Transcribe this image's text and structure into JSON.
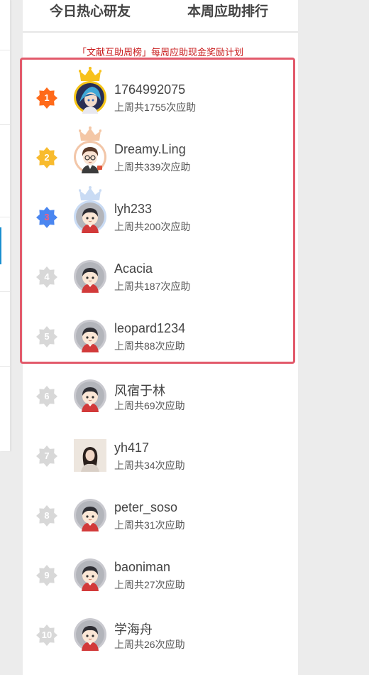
{
  "tabs": [
    {
      "label": "今日热心研友"
    },
    {
      "label": "本周应助排行"
    }
  ],
  "notice": "「文献互助周榜」每周应助现金奖励计划",
  "ranking": [
    {
      "rank": "1",
      "name": "1764992075",
      "stat": "上周共1755次应助",
      "badge_color": "#ff6a1a",
      "crown_color": "#f7c11a",
      "avatar": "anime-avatar"
    },
    {
      "rank": "2",
      "name": "Dreamy.Ling",
      "stat": "上周共339次应助",
      "badge_color": "#f8bb2e",
      "crown_color": "#f4c7a6",
      "avatar": "cartoon-boy-avatar"
    },
    {
      "rank": "3",
      "name": "lyh233",
      "stat": "上周共200次应助",
      "badge_color": "#4a86f0",
      "crown_color": "#c9dbf4",
      "avatar": "default-avatar"
    },
    {
      "rank": "4",
      "name": "Acacia",
      "stat": "上周共187次应助",
      "badge_color": "#d8d8d8",
      "avatar": "default-avatar"
    },
    {
      "rank": "5",
      "name": "leopard1234",
      "stat": "上周共88次应助",
      "badge_color": "#d8d8d8",
      "avatar": "default-avatar"
    },
    {
      "rank": "6",
      "name": "风宿于林",
      "stat": "上周共69次应助",
      "badge_color": "#d8d8d8",
      "avatar": "default-avatar"
    },
    {
      "rank": "7",
      "name": "yh417",
      "stat": "上周共34次应助",
      "badge_color": "#d8d8d8",
      "avatar": "photo-avatar"
    },
    {
      "rank": "8",
      "name": "peter_soso",
      "stat": "上周共31次应助",
      "badge_color": "#d8d8d8",
      "avatar": "default-avatar"
    },
    {
      "rank": "9",
      "name": "baoniman",
      "stat": "上周共27次应助",
      "badge_color": "#d8d8d8",
      "avatar": "default-avatar"
    },
    {
      "rank": "10",
      "name": "学海舟",
      "stat": "上周共26次应助",
      "badge_color": "#d8d8d8",
      "avatar": "default-avatar"
    }
  ]
}
